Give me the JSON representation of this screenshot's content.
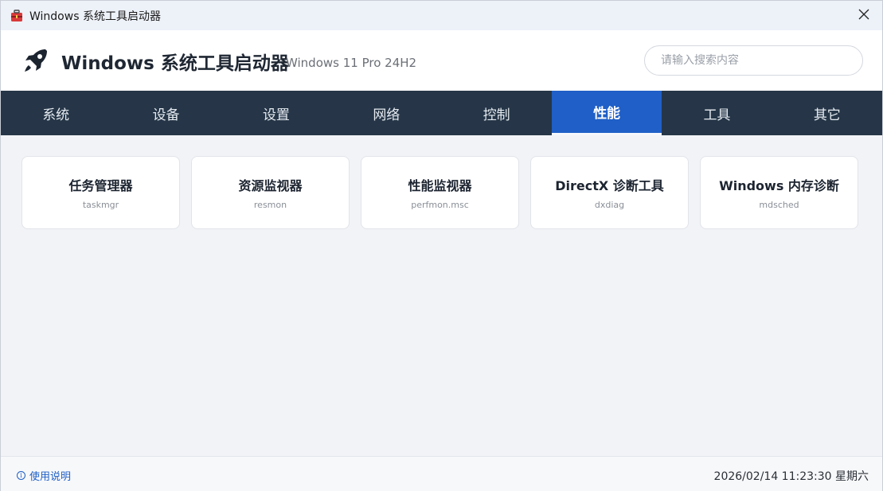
{
  "window": {
    "title": "Windows 系统工具启动器"
  },
  "header": {
    "title": "Windows 系统工具启动器",
    "subtitle": "Windows 11 Pro 24H2",
    "search_placeholder": "请输入搜索内容",
    "search_value": ""
  },
  "tabs": [
    {
      "label": "系统"
    },
    {
      "label": "设备"
    },
    {
      "label": "设置"
    },
    {
      "label": "网络"
    },
    {
      "label": "控制"
    },
    {
      "label": "性能",
      "active": true
    },
    {
      "label": "工具"
    },
    {
      "label": "其它"
    }
  ],
  "cards": [
    {
      "title": "任务管理器",
      "command": "taskmgr"
    },
    {
      "title": "资源监视器",
      "command": "resmon"
    },
    {
      "title": "性能监视器",
      "command": "perfmon.msc"
    },
    {
      "title": "DirectX 诊断工具",
      "command": "dxdiag"
    },
    {
      "title": "Windows 内存诊断",
      "command": "mdsched"
    }
  ],
  "footer": {
    "help_label": "使用说明",
    "datetime": "2026/02/14 11:23:30 星期六"
  },
  "icons": {
    "app": "toolbox-icon",
    "logo": "rocket-icon",
    "close": "close-icon",
    "help": "info-icon"
  },
  "colors": {
    "tab_bar": "#263648",
    "tab_active": "#1f5fc7",
    "accent": "#1f5fc7"
  }
}
